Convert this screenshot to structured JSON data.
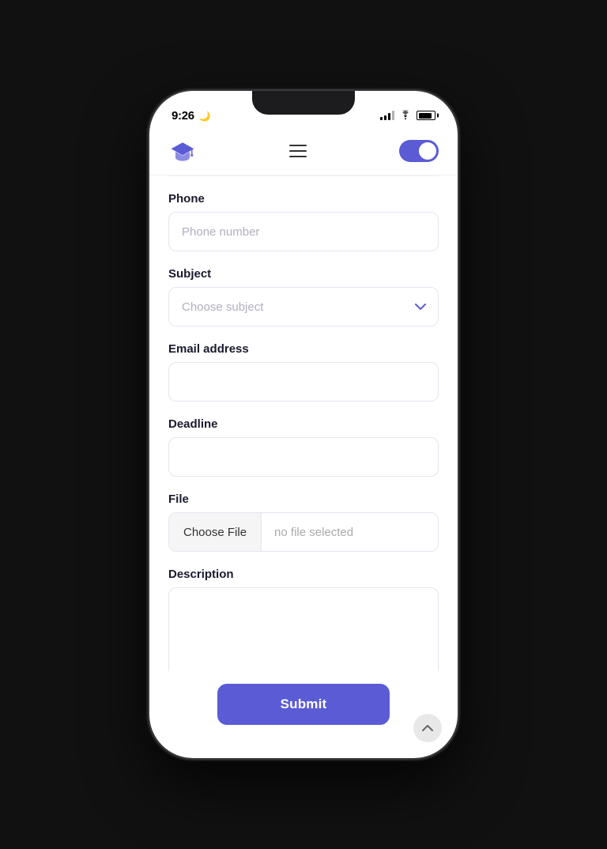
{
  "status_bar": {
    "time": "9:26",
    "moon": "🌙"
  },
  "header": {
    "logo_alt": "Education logo",
    "hamburger_label": "Menu",
    "toggle_label": "Theme toggle"
  },
  "form": {
    "phone_label": "Phone",
    "phone_placeholder": "Phone number",
    "subject_label": "Subject",
    "subject_placeholder": "Choose subject",
    "email_label": "Email address",
    "email_placeholder": "",
    "deadline_label": "Deadline",
    "deadline_placeholder": "",
    "file_label": "File",
    "file_button": "Choose File",
    "file_no_selection": "no file selected",
    "description_label": "Description",
    "description_placeholder": "",
    "submit_button": "Submit"
  },
  "colors": {
    "accent": "#5b5bd6",
    "border": "#e5e5f0",
    "text_primary": "#1a1a2e",
    "text_placeholder": "#b0b0c0"
  }
}
